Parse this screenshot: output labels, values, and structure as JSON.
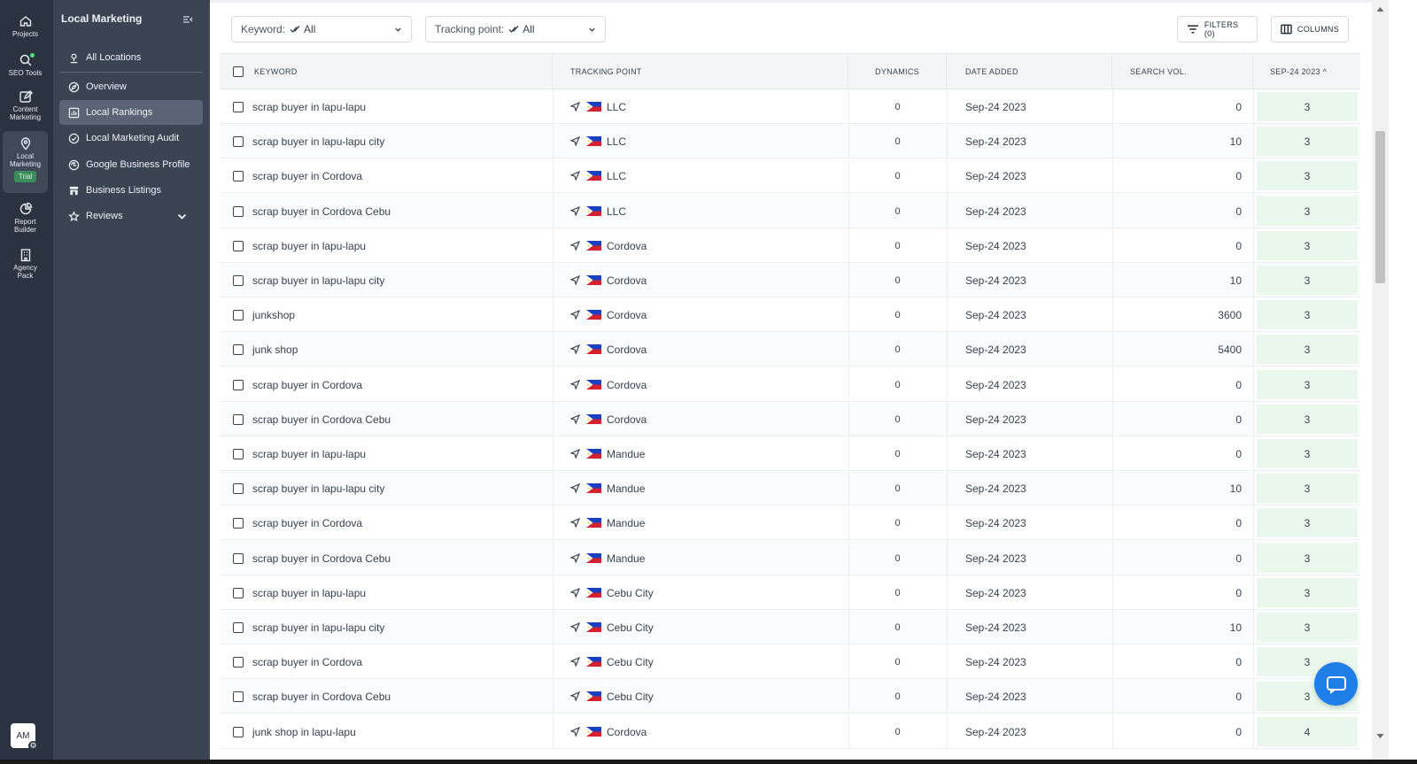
{
  "rail": {
    "items": [
      {
        "label": "Projects",
        "icon": "home-icon"
      },
      {
        "label": "SEO Tools",
        "icon": "search-icon"
      },
      {
        "label": "Content Marketing",
        "icon": "edit-icon"
      },
      {
        "label": "Local Marketing",
        "icon": "location-pin-icon",
        "badge": "Trial"
      },
      {
        "label": "Report Builder",
        "icon": "pie-chart-icon"
      },
      {
        "label": "Agency Pack",
        "icon": "building-icon"
      }
    ],
    "avatar": "AM"
  },
  "sidebar": {
    "title": "Local Marketing",
    "items": [
      {
        "label": "All Locations",
        "icon": "pin-icon"
      },
      {
        "label": "Overview",
        "icon": "compass-icon"
      },
      {
        "label": "Local Rankings",
        "icon": "rankings-icon"
      },
      {
        "label": "Local Marketing Audit",
        "icon": "check-circle-icon"
      },
      {
        "label": "Google Business Profile",
        "icon": "globe-icon"
      },
      {
        "label": "Business Listings",
        "icon": "store-icon"
      },
      {
        "label": "Reviews",
        "icon": "star-icon"
      }
    ]
  },
  "toolbar": {
    "keyword_label": "Keyword:",
    "keyword_value": "All",
    "tracking_label": "Tracking point:",
    "tracking_value": "All",
    "filters_label": "FILTERS (0)",
    "columns_label": "COLUMNS"
  },
  "table": {
    "headers": {
      "keyword": "KEYWORD",
      "tracking_point": "TRACKING POINT",
      "dynamics": "DYNAMICS",
      "date_added": "DATE ADDED",
      "search_vol": "SEARCH VOL.",
      "rank_col": "SEP-24 2023 ^"
    },
    "rows": [
      {
        "keyword": "scrap buyer in lapu-lapu",
        "tracking_point": "LLC",
        "dynamics": "0",
        "date_added": "Sep-24 2023",
        "search_vol": "0",
        "rank": "3"
      },
      {
        "keyword": "scrap buyer in lapu-lapu city",
        "tracking_point": "LLC",
        "dynamics": "0",
        "date_added": "Sep-24 2023",
        "search_vol": "10",
        "rank": "3"
      },
      {
        "keyword": "scrap buyer in Cordova",
        "tracking_point": "LLC",
        "dynamics": "0",
        "date_added": "Sep-24 2023",
        "search_vol": "0",
        "rank": "3"
      },
      {
        "keyword": "scrap buyer in Cordova Cebu",
        "tracking_point": "LLC",
        "dynamics": "0",
        "date_added": "Sep-24 2023",
        "search_vol": "0",
        "rank": "3"
      },
      {
        "keyword": "scrap buyer in lapu-lapu",
        "tracking_point": "Cordova",
        "dynamics": "0",
        "date_added": "Sep-24 2023",
        "search_vol": "0",
        "rank": "3"
      },
      {
        "keyword": "scrap buyer in lapu-lapu city",
        "tracking_point": "Cordova",
        "dynamics": "0",
        "date_added": "Sep-24 2023",
        "search_vol": "10",
        "rank": "3"
      },
      {
        "keyword": "junkshop",
        "tracking_point": "Cordova",
        "dynamics": "0",
        "date_added": "Sep-24 2023",
        "search_vol": "3600",
        "rank": "3"
      },
      {
        "keyword": "junk shop",
        "tracking_point": "Cordova",
        "dynamics": "0",
        "date_added": "Sep-24 2023",
        "search_vol": "5400",
        "rank": "3"
      },
      {
        "keyword": "scrap buyer in Cordova",
        "tracking_point": "Cordova",
        "dynamics": "0",
        "date_added": "Sep-24 2023",
        "search_vol": "0",
        "rank": "3"
      },
      {
        "keyword": "scrap buyer in Cordova Cebu",
        "tracking_point": "Cordova",
        "dynamics": "0",
        "date_added": "Sep-24 2023",
        "search_vol": "0",
        "rank": "3"
      },
      {
        "keyword": "scrap buyer in lapu-lapu",
        "tracking_point": "Mandue",
        "dynamics": "0",
        "date_added": "Sep-24 2023",
        "search_vol": "0",
        "rank": "3"
      },
      {
        "keyword": "scrap buyer in lapu-lapu city",
        "tracking_point": "Mandue",
        "dynamics": "0",
        "date_added": "Sep-24 2023",
        "search_vol": "10",
        "rank": "3"
      },
      {
        "keyword": "scrap buyer in Cordova",
        "tracking_point": "Mandue",
        "dynamics": "0",
        "date_added": "Sep-24 2023",
        "search_vol": "0",
        "rank": "3"
      },
      {
        "keyword": "scrap buyer in Cordova Cebu",
        "tracking_point": "Mandue",
        "dynamics": "0",
        "date_added": "Sep-24 2023",
        "search_vol": "0",
        "rank": "3"
      },
      {
        "keyword": "scrap buyer in lapu-lapu",
        "tracking_point": "Cebu City",
        "dynamics": "0",
        "date_added": "Sep-24 2023",
        "search_vol": "0",
        "rank": "3"
      },
      {
        "keyword": "scrap buyer in lapu-lapu city",
        "tracking_point": "Cebu City",
        "dynamics": "0",
        "date_added": "Sep-24 2023",
        "search_vol": "10",
        "rank": "3"
      },
      {
        "keyword": "scrap buyer in Cordova",
        "tracking_point": "Cebu City",
        "dynamics": "0",
        "date_added": "Sep-24 2023",
        "search_vol": "0",
        "rank": "3"
      },
      {
        "keyword": "scrap buyer in Cordova Cebu",
        "tracking_point": "Cebu City",
        "dynamics": "0",
        "date_added": "Sep-24 2023",
        "search_vol": "0",
        "rank": "3"
      },
      {
        "keyword": "junk shop in lapu-lapu",
        "tracking_point": "Cordova",
        "dynamics": "0",
        "date_added": "Sep-24 2023",
        "search_vol": "0",
        "rank": "4"
      }
    ]
  },
  "colors": {
    "rail_bg": "#2b3340",
    "sidebar_bg": "#3a4453",
    "rank_cell_bg": "#e9f7ec",
    "chat_button": "#1f7ee8",
    "trial_badge": "#3c8c5c"
  }
}
